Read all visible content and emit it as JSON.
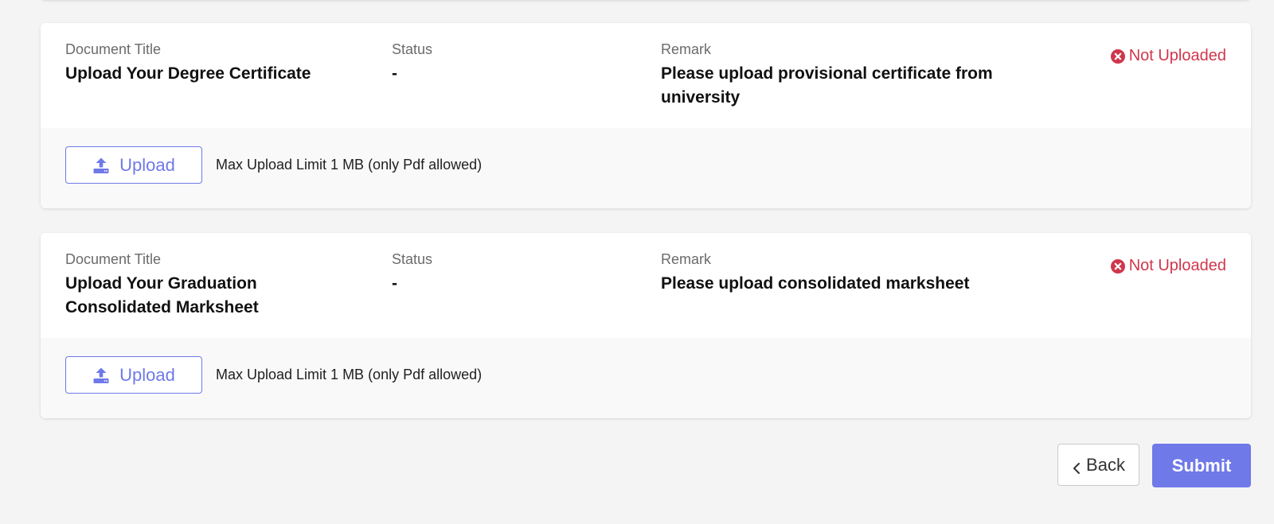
{
  "documents": [
    {
      "title_label": "Document Title",
      "title": "Upload Your Degree Certificate",
      "status_label": "Status",
      "status": "-",
      "remark_label": "Remark",
      "remark": "Please upload provisional certificate from university",
      "badge": "Not Uploaded",
      "upload_label": "Upload",
      "upload_limit": "Max Upload Limit 1 MB (only Pdf allowed)"
    },
    {
      "title_label": "Document Title",
      "title": "Upload Your Graduation Consolidated Marksheet",
      "status_label": "Status",
      "status": "-",
      "remark_label": "Remark",
      "remark": "Please upload consolidated marksheet",
      "badge": "Not Uploaded",
      "upload_label": "Upload",
      "upload_limit": "Max Upload Limit 1 MB (only Pdf allowed)"
    }
  ],
  "footer": {
    "back_label": "Back",
    "submit_label": "Submit"
  },
  "colors": {
    "accent": "#6f79e8",
    "error": "#d0364b",
    "background": "#f4f4f5"
  },
  "icons": {
    "upload": "upload-icon",
    "status": "x-circle-icon",
    "back": "chevron-left-icon"
  }
}
